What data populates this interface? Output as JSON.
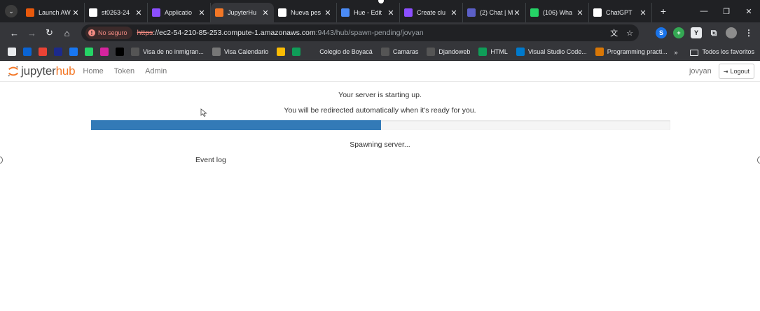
{
  "browser": {
    "tabs": [
      {
        "title": "Launch AW",
        "icon": "aws-icon",
        "color": "#e8590c",
        "active": false
      },
      {
        "title": "st0263-24",
        "icon": "github-icon",
        "color": "#ffffff",
        "active": false
      },
      {
        "title": "Applicatio",
        "icon": "emr-icon",
        "color": "#8c4fff",
        "active": false
      },
      {
        "title": "JupyterHu",
        "icon": "jupyter-icon",
        "color": "#f37726",
        "active": true
      },
      {
        "title": "Nueva pes",
        "icon": "chrome-icon",
        "color": "#ffffff",
        "active": false
      },
      {
        "title": "Hue - Edit",
        "icon": "hue-icon",
        "color": "#4b8bf5",
        "active": false
      },
      {
        "title": "Create clu",
        "icon": "emr-icon",
        "color": "#8c4fff",
        "active": false
      },
      {
        "title": "(2) Chat | M",
        "icon": "teams-icon",
        "color": "#5b5fc7",
        "active": false
      },
      {
        "title": "(106) Wha",
        "icon": "whatsapp-icon",
        "color": "#25d366",
        "active": false
      },
      {
        "title": "ChatGPT",
        "icon": "chatgpt-icon",
        "color": "#ffffff",
        "active": false
      }
    ],
    "new_tab_label": "+",
    "insecure_label": "No seguro",
    "url_scheme": "https",
    "url_host": "://ec2-54-210-85-253.compute-1.amazonaws.com",
    "url_path": ":9443/hub/spawn-pending/jovyan",
    "bookmarks": [
      {
        "label": "",
        "icon": "apps-grid-icon",
        "color": "#e8eaed"
      },
      {
        "label": "",
        "icon": "outlook-icon",
        "color": "#0a64d4"
      },
      {
        "label": "",
        "icon": "gmail-icon",
        "color": "#ea4335"
      },
      {
        "label": "",
        "icon": "kaggle-icon",
        "color": "#1c2a8c"
      },
      {
        "label": "",
        "icon": "facebook-icon",
        "color": "#1877f2"
      },
      {
        "label": "",
        "icon": "whatsapp-icon",
        "color": "#25d366"
      },
      {
        "label": "",
        "icon": "instagram-icon",
        "color": "#d6249f"
      },
      {
        "label": "",
        "icon": "x-icon",
        "color": "#000000"
      },
      {
        "label": "Visa de no inmigran...",
        "icon": "visa-icon",
        "color": "#555555"
      },
      {
        "label": "Visa Calendario",
        "icon": "link-icon",
        "color": "#777777"
      },
      {
        "label": "",
        "icon": "drive-icon",
        "color": "#fbbc04"
      },
      {
        "label": "",
        "icon": "sheets-icon",
        "color": "#0f9d58"
      },
      {
        "label": "Colegio de Boyacá",
        "icon": "school-icon",
        "color": "#35363a"
      },
      {
        "label": "Camaras",
        "icon": "camera-icon",
        "color": "#555555"
      },
      {
        "label": "Djandoweb",
        "icon": "globe-icon",
        "color": "#555555"
      },
      {
        "label": "HTML",
        "icon": "html-icon",
        "color": "#0f9d58"
      },
      {
        "label": "Visual Studio Code...",
        "icon": "vscode-icon",
        "color": "#007acc"
      },
      {
        "label": "Programming practi...",
        "icon": "code-icon",
        "color": "#d97706"
      }
    ],
    "bookmarks_overflow": "»",
    "all_bookmarks_label": "Todos los favoritos"
  },
  "jupyterhub": {
    "logo_prefix": "jupyter",
    "logo_suffix": "hub",
    "nav": {
      "home": "Home",
      "token": "Token",
      "admin": "Admin"
    },
    "username": "jovyan",
    "logout": "Logout",
    "message_line1": "Your server is starting up.",
    "message_line2": "You will be redirected automatically when it's ready for you.",
    "progress_percent": 50,
    "status": "Spawning server...",
    "event_log": "Event log",
    "colors": {
      "brand": "#f37726",
      "progress": "#337ab7"
    }
  }
}
